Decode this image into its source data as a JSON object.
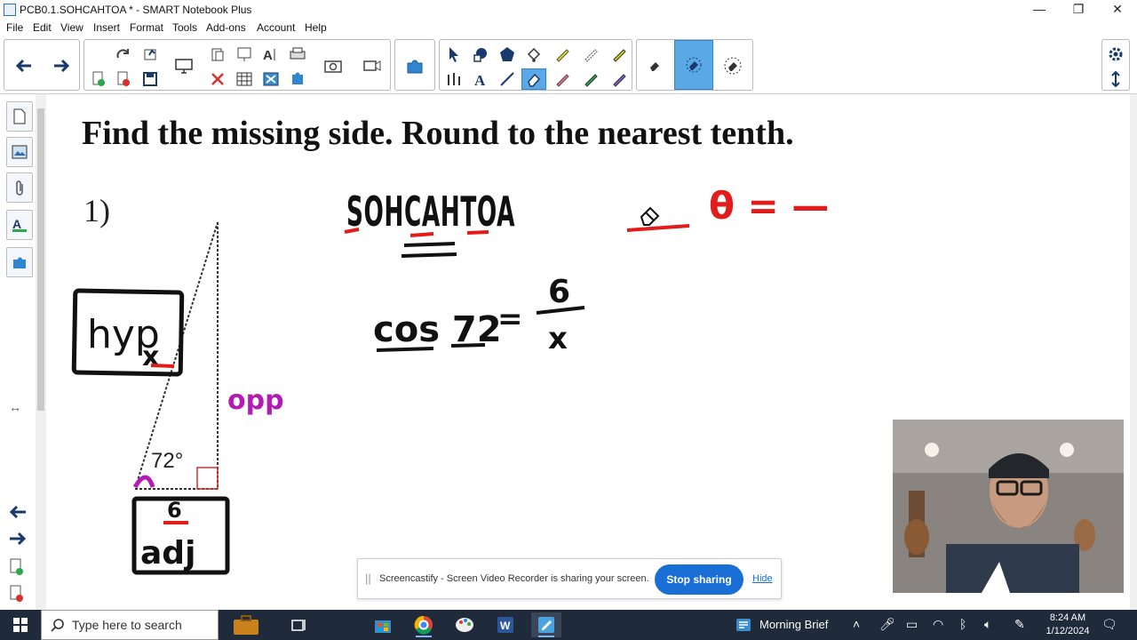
{
  "window": {
    "title": "PCB0.1.SOHCAHTOA * - SMART Notebook Plus",
    "controls": [
      "—",
      "❐",
      "✕"
    ]
  },
  "menu": [
    "File",
    "Edit",
    "View",
    "Insert",
    "Format",
    "Tools",
    "Add-ons",
    "Account",
    "Help"
  ],
  "page": {
    "instruction": "Find the missing side.  Round to the nearest tenth.",
    "problem_number": "1)",
    "angle_label": "72°",
    "handwriting": {
      "mnemonic": "SOHCAHTOA",
      "equation_left": "cos 72",
      "equals": "=",
      "numerator": "6",
      "denominator": "x",
      "theta_note": "θ = —",
      "hyp_label": "hyp",
      "x_label": "x",
      "opp_label": "opp",
      "side_value": "6",
      "adj_label": "adj"
    }
  },
  "screen_share": {
    "grip": "||",
    "message": "Screencastify - Screen Video Recorder is sharing your screen.",
    "stop_label": "Stop sharing",
    "hide_label": "Hide"
  },
  "taskbar": {
    "search_placeholder": "Type here to search",
    "news": "Morning Brief",
    "time": "8:24 AM",
    "date": "1/12/2024"
  },
  "colors": {
    "accent_blue": "#1a6fd6",
    "ink_black": "#111111",
    "ink_red": "#e21b1b",
    "ink_purple": "#b41ab4",
    "active_tool": "#5aa9e6",
    "taskbar": "#1f2a3a"
  }
}
